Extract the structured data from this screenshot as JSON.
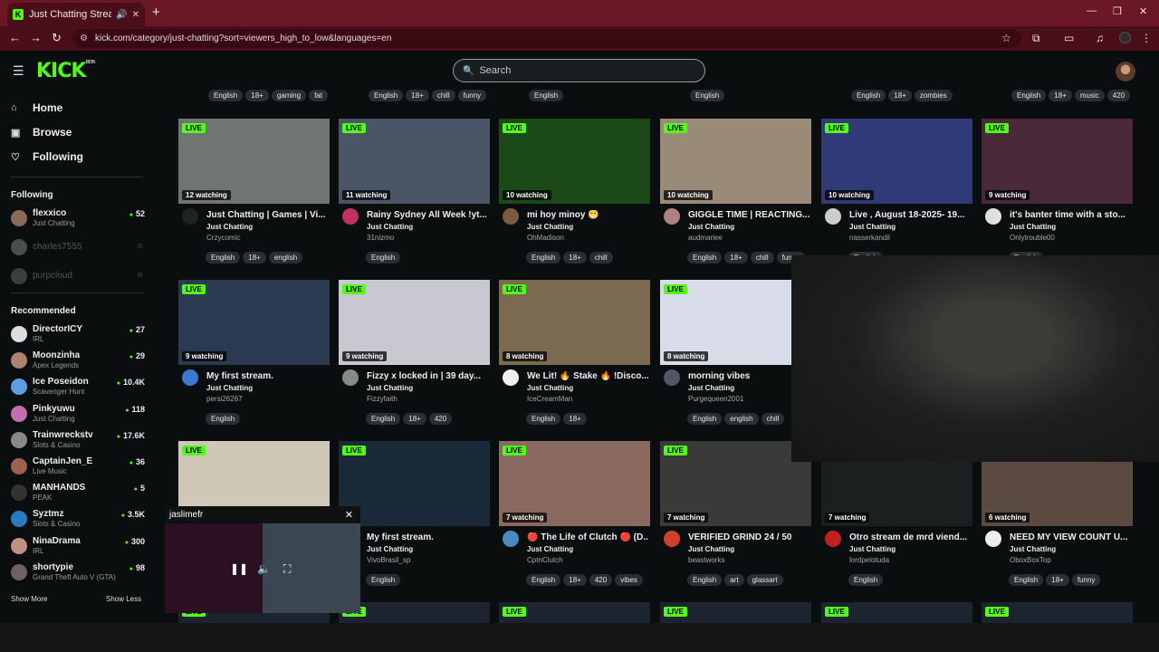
{
  "browser": {
    "tab_title": "Just Chatting Streaming - L",
    "url": "kick.com/category/just-chatting?sort=viewers_high_to_low&languages=en"
  },
  "header": {
    "logo": "KICK",
    "logo_badge": "BETA",
    "search_placeholder": "Search"
  },
  "sidebar": {
    "nav": [
      {
        "label": "Home",
        "icon": "home-icon"
      },
      {
        "label": "Browse",
        "icon": "browse-icon"
      },
      {
        "label": "Following",
        "icon": "heart-icon"
      }
    ],
    "following_title": "Following",
    "following": [
      {
        "name": "flexxico",
        "category": "Just Chatting",
        "viewers": "52",
        "online": true,
        "color": "#8a6a5a"
      },
      {
        "name": "charles7555",
        "category": "",
        "viewers": "",
        "online": false,
        "color": "#999"
      },
      {
        "name": "purpcloud",
        "category": "",
        "viewers": "",
        "online": false,
        "color": "#777"
      }
    ],
    "recommended_title": "Recommended",
    "recommended": [
      {
        "name": "DirectorICY",
        "category": "IRL",
        "viewers": "27",
        "color": "#ddd"
      },
      {
        "name": "Moonzinha",
        "category": "Apex Legends",
        "viewers": "29",
        "color": "#b08070"
      },
      {
        "name": "Ice Poseidon",
        "category": "Scavenger Hunt",
        "viewers": "10.4K",
        "color": "#5aa0e0"
      },
      {
        "name": "Pinkyuwu",
        "category": "Just Chatting",
        "viewers": "118",
        "color": "#c070b0"
      },
      {
        "name": "Trainwreckstv",
        "category": "Slots & Casino",
        "viewers": "17.6K",
        "color": "#888"
      },
      {
        "name": "CaptainJen_E",
        "category": "Live Music",
        "viewers": "36",
        "color": "#a06050"
      },
      {
        "name": "MANHANDS",
        "category": "PEAK",
        "viewers": "5",
        "color": "#333"
      },
      {
        "name": "Syztmz",
        "category": "Slots & Casino",
        "viewers": "3.5K",
        "color": "#2a7ac0"
      },
      {
        "name": "NinaDrama",
        "category": "IRL",
        "viewers": "300",
        "color": "#c09080"
      },
      {
        "name": "shortypie",
        "category": "Grand Theft Auto V (GTA)",
        "viewers": "98",
        "color": "#706060"
      }
    ],
    "show_more": "Show More",
    "show_less": "Show Less"
  },
  "top_tags": [
    [
      "English",
      "18+",
      "gaming",
      "fat"
    ],
    [
      "English",
      "18+",
      "chill",
      "funny"
    ],
    [
      "English"
    ],
    [
      "English"
    ],
    [
      "English",
      "18+",
      "zombies"
    ],
    [
      "English",
      "18+",
      "music",
      "420"
    ]
  ],
  "streams": [
    {
      "title": "Just Chatting | Games | Vi...",
      "category": "Just Chatting",
      "user": "Crzycomic",
      "watching": "12 watching",
      "tags": [
        "English",
        "18+",
        "english"
      ],
      "thumb": "#6f7570",
      "avatar": "#222"
    },
    {
      "title": "Rainy Sydney All Week !yt...",
      "category": "Just Chatting",
      "user": "31nizmo",
      "watching": "11 watching",
      "tags": [
        "English"
      ],
      "thumb": "#4a5566",
      "avatar": "#c03060"
    },
    {
      "title": "mi hoy minoy 😁",
      "category": "Just Chatting",
      "user": "OhMadison",
      "watching": "10 watching",
      "tags": [
        "English",
        "18+",
        "chill"
      ],
      "thumb": "#1b4a18",
      "avatar": "#7a5a40"
    },
    {
      "title": "GIGGLE TIME | REACTING...",
      "category": "Just Chatting",
      "user": "audmariee",
      "watching": "10 watching",
      "tags": [
        "English",
        "18+",
        "chill",
        "funny"
      ],
      "thumb": "#9a8a78",
      "avatar": "#b08080"
    },
    {
      "title": "Live , August 18-2025- 19...",
      "category": "Just Chatting",
      "user": "nasserkandil",
      "watching": "10 watching",
      "tags": [
        "English"
      ],
      "thumb": "#303a78",
      "avatar": "#ccc"
    },
    {
      "title": "it's banter time with a sto...",
      "category": "Just Chatting",
      "user": "Onlytrouble00",
      "watching": "9 watching",
      "tags": [
        "English"
      ],
      "thumb": "#4a2a3a",
      "avatar": "#e0e0e0"
    },
    {
      "title": "My first stream.",
      "category": "Just Chatting",
      "user": "persi26267",
      "watching": "9 watching",
      "tags": [
        "English"
      ],
      "thumb": "#2a3a50",
      "avatar": "#3a7ad0"
    },
    {
      "title": "Fizzy x locked in | 39 day...",
      "category": "Just Chatting",
      "user": "Fizzyfaith",
      "watching": "9 watching",
      "tags": [
        "English",
        "18+",
        "420"
      ],
      "thumb": "#c8c8d0",
      "avatar": "#888"
    },
    {
      "title": "We Lit! 🔥 Stake 🔥 !Disco...",
      "category": "Just Chatting",
      "user": "IceCreamMan",
      "watching": "8 watching",
      "tags": [
        "English",
        "18+"
      ],
      "thumb": "#7a6a50",
      "avatar": "#eee"
    },
    {
      "title": "morning vibes",
      "category": "Just Chatting",
      "user": "Purgequeen2001",
      "watching": "8 watching",
      "tags": [
        "English",
        "english",
        "chill"
      ],
      "thumb": "#d8dce8",
      "avatar": "#556"
    },
    {
      "title": "",
      "category": "",
      "user": "",
      "watching": "",
      "tags": [],
      "thumb": "#1e1f1e",
      "avatar": "#111"
    },
    {
      "title": "",
      "category": "",
      "user": "",
      "watching": "",
      "tags": [],
      "thumb": "#1e1f1e",
      "avatar": "#111"
    },
    {
      "title": "",
      "category": "",
      "user": "",
      "watching": "",
      "tags": [],
      "thumb": "#cfc8b8",
      "avatar": "#333"
    },
    {
      "title": "My first stream.",
      "category": "Just Chatting",
      "user": "VivoBrasil_sp",
      "watching": "",
      "tags": [
        "English"
      ],
      "thumb": "#1a2a3a",
      "avatar": "#333"
    },
    {
      "title": "🔴 The Life of Clutch 🔴 (D...",
      "category": "Just Chatting",
      "user": "CptnClutch",
      "watching": "7 watching",
      "tags": [
        "English",
        "18+",
        "420",
        "vibes"
      ],
      "thumb": "#8a6a60",
      "avatar": "#4a8ac0"
    },
    {
      "title": "VERIFIED GRIND 24 / 50",
      "category": "Just Chatting",
      "user": "beastworks",
      "watching": "7 watching",
      "tags": [
        "English",
        "art",
        "glassart"
      ],
      "thumb": "#3a3a38",
      "avatar": "#d04030"
    },
    {
      "title": "Otro stream de mrd viend...",
      "category": "Just Chatting",
      "user": "lordpelotuda",
      "watching": "7 watching",
      "tags": [
        "English"
      ],
      "thumb": "#1a2020",
      "avatar": "#c02020"
    },
    {
      "title": "NEED MY VIEW COUNT U...",
      "category": "Just Chatting",
      "user": "OboxBoxTop",
      "watching": "6 watching",
      "tags": [
        "English",
        "18+",
        "funny"
      ],
      "thumb": "#5a4a40",
      "avatar": "#eee"
    }
  ],
  "bottom_row_live": [
    "LIVE",
    "LIVE",
    "LIVE",
    "LIVE",
    "LIVE",
    "LIVE"
  ],
  "mini_player": {
    "name": "jaslimefr"
  }
}
